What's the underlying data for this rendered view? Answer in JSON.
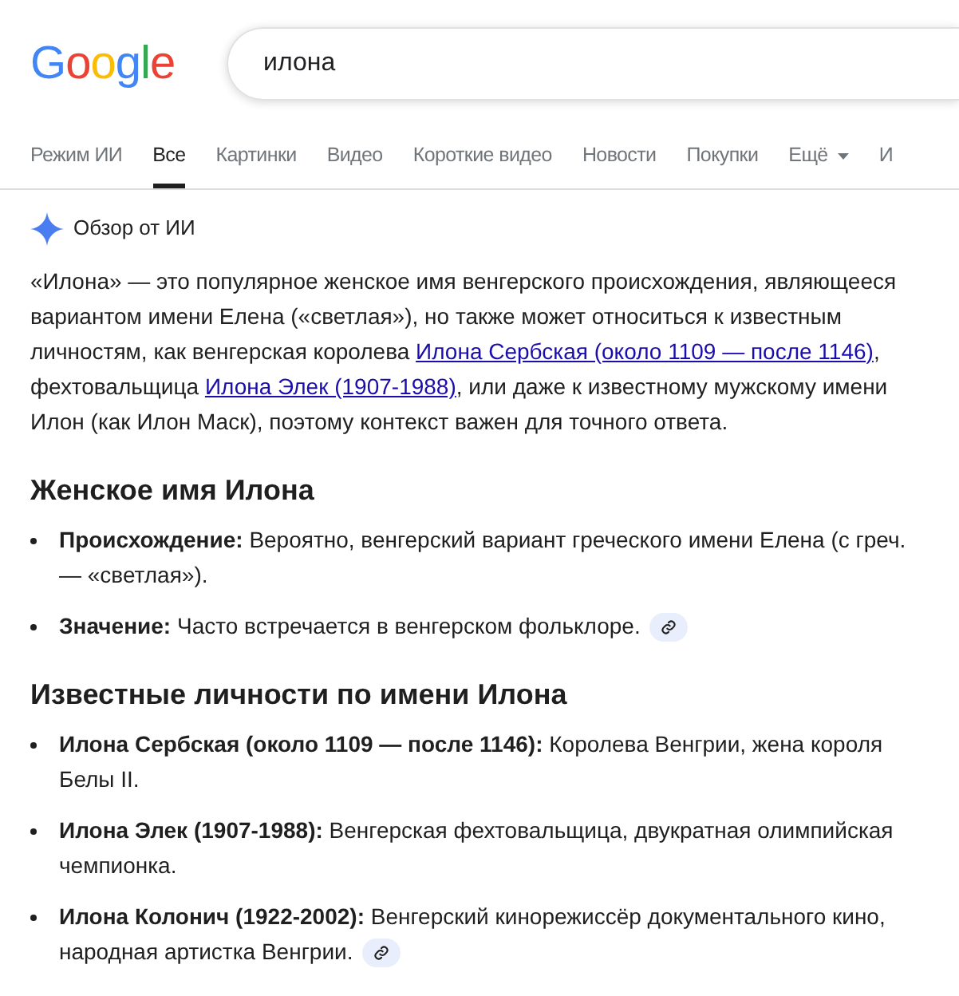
{
  "logo": "Google",
  "search": {
    "value": "илона"
  },
  "tabs": [
    {
      "label": "Режим ИИ",
      "selected": false,
      "dropdown": false
    },
    {
      "label": "Все",
      "selected": true,
      "dropdown": false
    },
    {
      "label": "Картинки",
      "selected": false,
      "dropdown": false
    },
    {
      "label": "Видео",
      "selected": false,
      "dropdown": false
    },
    {
      "label": "Короткие видео",
      "selected": false,
      "dropdown": false
    },
    {
      "label": "Новости",
      "selected": false,
      "dropdown": false
    },
    {
      "label": "Покупки",
      "selected": false,
      "dropdown": false
    },
    {
      "label": "Ещё",
      "selected": false,
      "dropdown": true
    },
    {
      "label": "И",
      "selected": false,
      "dropdown": false
    }
  ],
  "ai_overview": {
    "title": "Обзор от ИИ",
    "intro": [
      {
        "kind": "text",
        "text": "«Илона» — это популярное женское имя венгерского происхождения, являющееся вариантом имени Елена («светлая»), но также может относиться к известным личностям, как венгерская королева "
      },
      {
        "kind": "link",
        "text": "Илона Сербская (около 1109 — после 1146)"
      },
      {
        "kind": "text",
        "text": ", фехтовальщица "
      },
      {
        "kind": "link",
        "text": "Илона Элек (1907-1988)"
      },
      {
        "kind": "text",
        "text": ", или даже к известному мужскому имени Илон (как Илон Маск), поэтому контекст важен для точного ответа."
      }
    ],
    "sections": [
      {
        "heading": "Женское имя Илона",
        "items": [
          {
            "term": "Происхождение:",
            "text": "Вероятно, венгерский вариант греческого имени Елена (с греч. — «светлая»).",
            "source_link": false
          },
          {
            "term": "Значение:",
            "text": "Часто встречается в венгерском фольклоре.",
            "source_link": true
          }
        ]
      },
      {
        "heading": "Известные личности по имени Илона",
        "items": [
          {
            "term": "Илона Сербская (около 1109 — после 1146):",
            "text": "Королева Венгрии, жена короля Белы II.",
            "source_link": false
          },
          {
            "term": "Илона Элек (1907-1988):",
            "text": "Венгерская фехтовальщица, двукратная олимпийская чемпионка.",
            "source_link": false
          },
          {
            "term": "Илона Колонич (1922-2002):",
            "text": "Венгерский кинорежиссёр документального кино, народная артистка Венгрии.",
            "source_link": true
          }
        ]
      }
    ]
  }
}
